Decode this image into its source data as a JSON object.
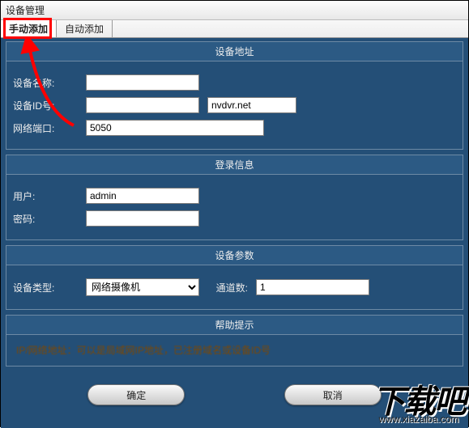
{
  "window": {
    "title": "设备管理"
  },
  "tabs": {
    "manual": "手动添加",
    "auto": "自动添加"
  },
  "sections": {
    "addr": {
      "title": "设备地址",
      "device_name_label": "设备名称:",
      "device_name_value": "",
      "device_id_label": "设备ID号:",
      "device_id_value": "",
      "domain_suffix": "nvdvr.net",
      "port_label": "网络端口:",
      "port_value": "5050"
    },
    "login": {
      "title": "登录信息",
      "user_label": "用户:",
      "user_value": "admin",
      "pass_label": "密码:",
      "pass_value": ""
    },
    "params": {
      "title": "设备参数",
      "type_label": "设备类型:",
      "type_value": "网络摄像机",
      "channels_label": "通道数:",
      "channels_value": "1"
    },
    "help": {
      "title": "帮助提示",
      "text": "IP/网络地址：可以是局域网IP地址，已注册域名或设备ID号"
    }
  },
  "buttons": {
    "ok": "确定",
    "cancel": "取消"
  },
  "watermark": {
    "big": "下载吧",
    "url": "www.xiazaiba.com"
  }
}
